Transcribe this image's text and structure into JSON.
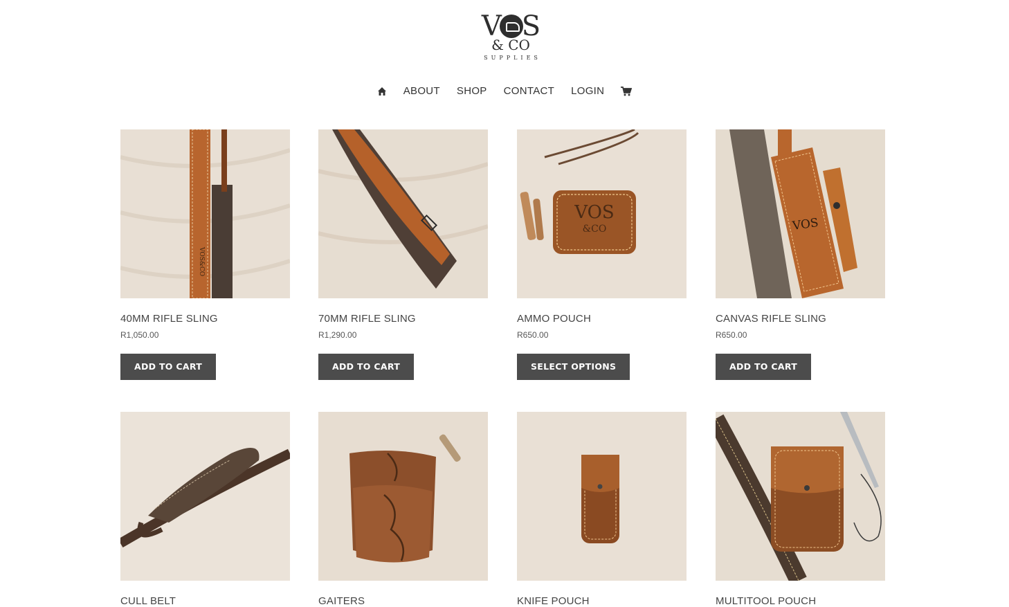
{
  "brand": {
    "line1_left": "V",
    "line1_right": "S",
    "line2": "& CO",
    "line3": "SUPPLIES"
  },
  "nav": {
    "home_icon": "home-icon",
    "items": [
      "ABOUT",
      "SHOP",
      "CONTACT",
      "LOGIN"
    ],
    "cart_icon": "cart-icon"
  },
  "products": [
    {
      "name": "40MM RIFLE SLING",
      "price": "R1,050.00",
      "button": "ADD TO CART"
    },
    {
      "name": "70MM RIFLE SLING",
      "price": "R1,290.00",
      "button": "ADD TO CART"
    },
    {
      "name": "AMMO POUCH",
      "price": "R650.00",
      "button": "SELECT OPTIONS"
    },
    {
      "name": "CANVAS RIFLE SLING",
      "price": "R650.00",
      "button": "ADD TO CART"
    },
    {
      "name": "CULL BELT"
    },
    {
      "name": "GAITERS"
    },
    {
      "name": "KNIFE POUCH"
    },
    {
      "name": "MULTITOOL POUCH"
    }
  ],
  "colors": {
    "button_bg": "#4c4c4c",
    "leather": "#b5632c",
    "wood": "#e7ddd1"
  }
}
